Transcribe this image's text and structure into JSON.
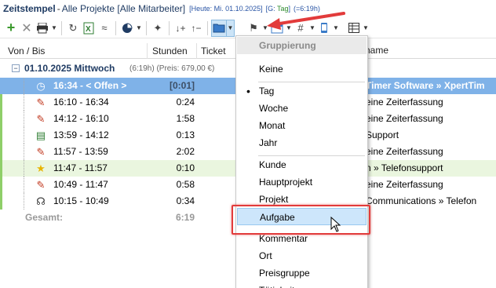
{
  "titlebar": {
    "app": "Zeitstempel",
    "separator": "-",
    "subtitle": "Alle Projekte [Alle Mitarbeiter]",
    "info": "[Heute: Mi. 01.10.2025]",
    "g_prefix": "[G:",
    "g_value": "Tag",
    "g_suffix": "]",
    "total": "(=6:19h)"
  },
  "toolbar": {
    "icons": [
      "add-icon",
      "delete-icon",
      "print-icon",
      "refresh-icon",
      "export-excel-icon",
      "approx-icon",
      "chart-icon",
      "wizard-icon",
      "sort-down-icon",
      "sort-up-icon",
      "grouping-folder-icon",
      "flag-icon",
      "calendar-icon",
      "hash-icon",
      "phone-icon",
      "table-icon"
    ]
  },
  "grid": {
    "columns": [
      "Von / Bis",
      "Stunden",
      "Ticket"
    ],
    "name_column": "name",
    "group": {
      "date": "01.10.2025 Mittwoch",
      "info": "(6:19h) (Preis: 679,00 €)"
    },
    "rows": [
      {
        "time": "16:34 - < Offen >",
        "hours": "[0:01]",
        "rest": "Timer Software » XpertTim",
        "icon": "clock-icon",
        "open": true
      },
      {
        "time": "16:10 - 16:34",
        "hours": "0:24",
        "rest": "eine Zeiterfassung",
        "icon": "pencil-icon"
      },
      {
        "time": "14:12 - 16:10",
        "hours": "1:58",
        "rest": "eine Zeiterfassung",
        "icon": "pencil-icon"
      },
      {
        "time": "13:59 - 14:12",
        "hours": "0:13",
        "rest": "Support",
        "icon": "book-icon"
      },
      {
        "time": "11:57 - 13:59",
        "hours": "2:02",
        "rest": "eine Zeiterfassung",
        "icon": "pencil-icon"
      },
      {
        "time": "11:47 - 11:57",
        "hours": "0:10",
        "rest": "n » Telefonsupport",
        "icon": "star-icon",
        "highlight": true
      },
      {
        "time": "10:49 - 11:47",
        "hours": "0:58",
        "rest": "eine Zeiterfassung",
        "icon": "pencil-icon"
      },
      {
        "time": "10:15 - 10:49",
        "hours": "0:34",
        "rest": "Communications » Telefon",
        "icon": "headset-icon"
      }
    ],
    "total": {
      "label": "Gesamt:",
      "hours": "6:19"
    }
  },
  "menu": {
    "title": "Gruppierung",
    "items": [
      "Keine",
      "Tag",
      "Woche",
      "Monat",
      "Jahr",
      "Kunde",
      "Hauptprojekt",
      "Projekt",
      "Aufgabe",
      "Kommentar",
      "Ort",
      "Preisgruppe",
      "Tätigkeit"
    ],
    "selected": "Tag",
    "hovered": "Aufgabe"
  },
  "colors": {
    "accent": "#1f3b63",
    "open_row": "#7fb2e8",
    "highlight_row": "#eaf6df",
    "callout_red": "#e23b3b",
    "menu_hover": "#cde6fb"
  }
}
